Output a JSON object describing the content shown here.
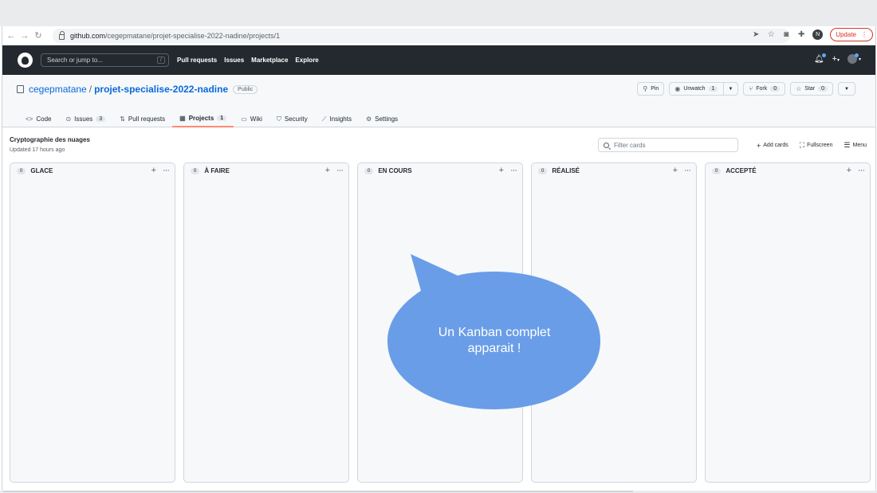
{
  "browser": {
    "url_domain": "github.com",
    "url_path": "/cegepmatane/projet-specialise-2022-nadine/projects/1",
    "update_label": "Update",
    "profile_initial": "N"
  },
  "header": {
    "search_placeholder": "Search or jump to...",
    "search_shortcut": "/",
    "nav": [
      "Pull requests",
      "Issues",
      "Marketplace",
      "Explore"
    ]
  },
  "repo": {
    "owner": "cegepmatane",
    "separator": "/",
    "name": "projet-specialise-2022-nadine",
    "visibility": "Public",
    "actions": {
      "pin": "Pin",
      "unwatch": "Unwatch",
      "unwatch_count": "1",
      "fork": "Fork",
      "fork_count": "0",
      "star": "Star",
      "star_count": "0"
    },
    "tabs": [
      {
        "label": "Code",
        "icon": "code-icon"
      },
      {
        "label": "Issues",
        "count": "3",
        "icon": "issue-icon"
      },
      {
        "label": "Pull requests",
        "icon": "pull-request-icon"
      },
      {
        "label": "Projects",
        "count": "1",
        "icon": "project-icon",
        "active": true
      },
      {
        "label": "Wiki",
        "icon": "book-icon"
      },
      {
        "label": "Security",
        "icon": "shield-icon"
      },
      {
        "label": "Insights",
        "icon": "graph-icon"
      },
      {
        "label": "Settings",
        "icon": "gear-icon"
      }
    ]
  },
  "project": {
    "name": "Cryptographie des nuages",
    "updated": "Updated 17 hours ago",
    "filter_placeholder": "Filter cards",
    "add_cards": "Add cards",
    "fullscreen": "Fullscreen",
    "menu": "Menu"
  },
  "columns": [
    {
      "count": "0",
      "title": "GLACE"
    },
    {
      "count": "0",
      "title": "À FAIRE"
    },
    {
      "count": "0",
      "title": "EN COURS"
    },
    {
      "count": "0",
      "title": "RÉALISÉ"
    },
    {
      "count": "0",
      "title": "ACCEPTÉ"
    }
  ],
  "bubble": {
    "line1": "Un Kanban complet",
    "line2": "apparait !",
    "color": "#6a9de8"
  },
  "colors": {
    "header_bg": "#24292f",
    "link": "#0969da",
    "active_tab": "#fd8c73"
  }
}
